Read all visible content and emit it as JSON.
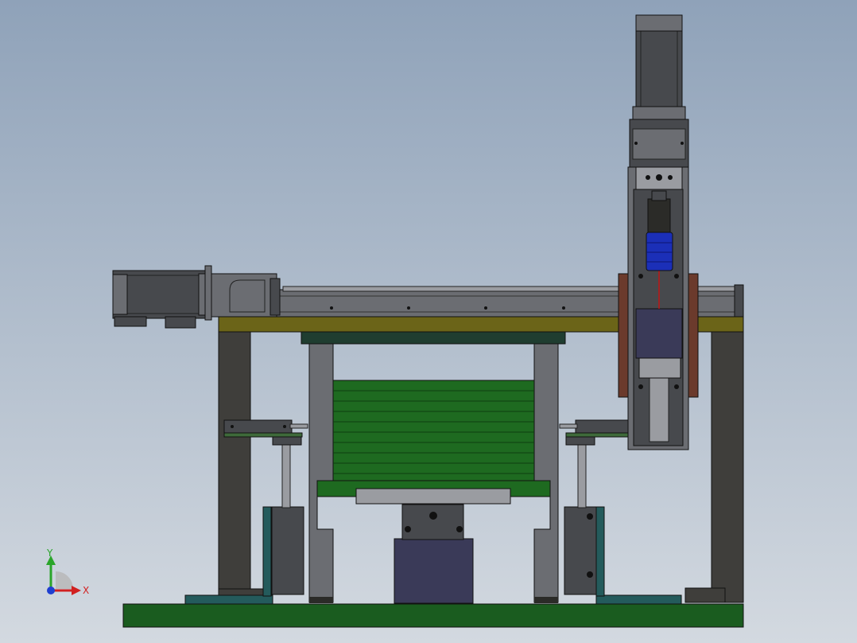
{
  "viewport": {
    "background_top": "#8fa2b9",
    "background_bottom": "#d3d9e0"
  },
  "colors": {
    "base_plate": "#1a5c1f",
    "top_plate": "#6b6418",
    "frame": "#3f3e3b",
    "frame_dark": "#2b2b28",
    "steel": "#6b6d72",
    "steel_light": "#9a9ca1",
    "steel_dark": "#47494d",
    "teal_bracket": "#245b5c",
    "dark_green_bar": "#1f3d30",
    "green_stack": "#1e6a20",
    "green_line": "#0d3d10",
    "navy_block": "#3a3a58",
    "blue_coupling": "#1b2fb8",
    "rust_plate": "#6b3a2c",
    "green_bracket": "#3e6a3a",
    "red_line": "#c01515"
  },
  "axis_triad": {
    "y_label": "Y",
    "x_label": "X",
    "y_color": "#2aa52a",
    "x_color": "#d12020",
    "z_color": "#1f3fd0"
  }
}
